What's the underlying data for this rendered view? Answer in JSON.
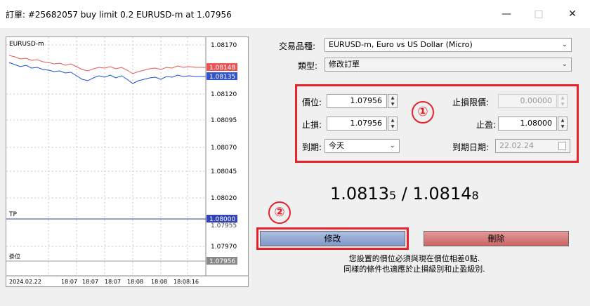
{
  "window": {
    "title": "訂單: #25682057 buy limit 0.2 EURUSD-m at 1.07956",
    "minimize": "—",
    "maximize": "□",
    "close": "✕"
  },
  "chart": {
    "symbol": "EURUSD-m",
    "y_ticks": [
      "1.08170",
      "1.08120",
      "1.08095",
      "1.08070",
      "1.08045",
      "1.08020",
      "1.07970"
    ],
    "x_ticks": [
      "2024.02.22",
      "18:07",
      "18:07",
      "18:07",
      "18:08",
      "18:08",
      "18:08:16"
    ],
    "price_tags": [
      {
        "label": "1.08148",
        "color": "#e85555"
      },
      {
        "label": "1.08135",
        "color": "#3355cc"
      },
      {
        "label": "1.08000",
        "color": "#3344bb"
      },
      {
        "label": "1.07956",
        "color": "#888888"
      }
    ],
    "hidden_tag": "1.07955",
    "line_labels": {
      "tp": "TP",
      "pending": "掛位"
    }
  },
  "form": {
    "symbol_label": "交易品種:",
    "symbol_value": "EURUSD-m, Euro vs US Dollar (Micro)",
    "type_label": "類型:",
    "type_value": "修改訂單",
    "price_label": "價位:",
    "price_value": "1.07956",
    "sl_label": "止損:",
    "sl_value": "1.07956",
    "expiry_label": "到期:",
    "expiry_value": "今天",
    "stop_limit_label": "止損限價:",
    "stop_limit_value": "0.00000",
    "tp_label": "止盈:",
    "tp_value": "1.08000",
    "expiry_date_label": "到期日期:",
    "expiry_date_value": "22.02.24"
  },
  "quote": {
    "bid_main": "1.0813",
    "bid_small": "5",
    "sep": " / ",
    "ask_main": "1.0814",
    "ask_small": "8"
  },
  "annotations": {
    "one": "①",
    "two": "②"
  },
  "buttons": {
    "modify": "修改",
    "delete": "刪除"
  },
  "note": {
    "line1": "您設置的價位必須與現在價位相差0點.",
    "line2": "同樣的條件也適應於止損級別和止盈級別."
  },
  "colors": {
    "highlight": "#e8212a",
    "ask_line": "#e85555",
    "bid_line": "#1f4fd8",
    "tp_line": "#2f3fae"
  }
}
